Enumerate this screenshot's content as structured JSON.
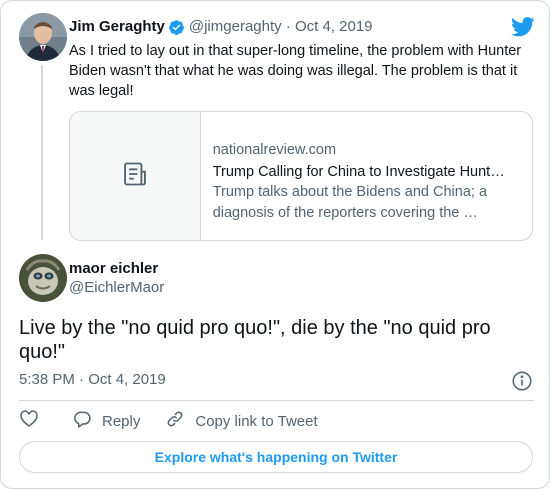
{
  "colors": {
    "accent": "#1d9bf0",
    "text": "#0f1419",
    "secondary": "#536471",
    "border": "#cfd9de"
  },
  "quoted_tweet": {
    "author_name": "Jim Geraghty",
    "meta": "@jimgeraghty · Oct 4, 2019",
    "verified_icon": "verified-badge-icon",
    "text": "As I tried to lay out in that super-long timeline, the problem with Hunter Biden wasn't that what he was doing was illegal. The problem is that it was legal!",
    "link_card": {
      "domain": "nationalreview.com",
      "title": "Trump Calling for China to Investigate Hunt…",
      "description": "Trump talks about the Bidens and China; a diagnosis of the reporters covering the …",
      "thumbnail_icon": "article-icon"
    }
  },
  "tweet": {
    "author_name": "maor eichler",
    "handle": "@EichlerMaor",
    "text": "Live by the \"no quid pro quo!\", die by the \"no quid pro quo!\"",
    "timestamp": "5:38 PM · Oct 4, 2019"
  },
  "actions": {
    "like_icon": "heart-icon",
    "reply_label": "Reply",
    "copy_link_label": "Copy link to Tweet"
  },
  "explore_button_label": "Explore what's happening on Twitter"
}
